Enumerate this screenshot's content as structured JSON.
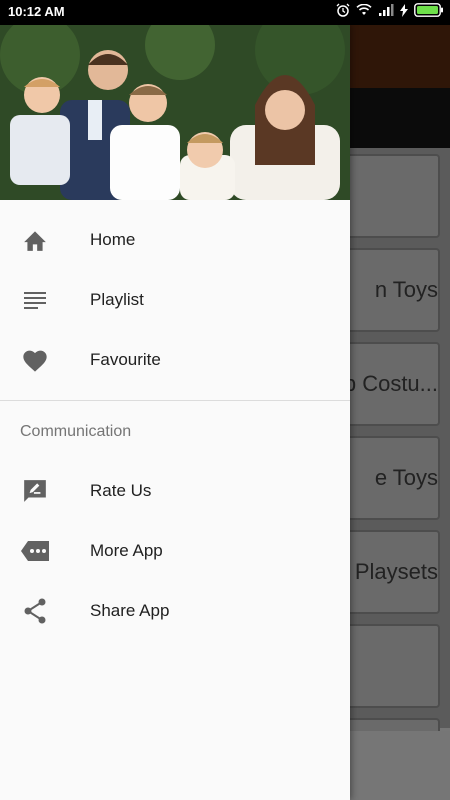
{
  "status_bar": {
    "time": "10:12 AM",
    "icons": [
      "alarm-icon",
      "wifi-icon",
      "signal-icon",
      "charging-icon",
      "battery-icon"
    ]
  },
  "background": {
    "cards": [
      "",
      "n Toys",
      "p Costu...",
      "e Toys",
      "Playsets",
      "",
      ""
    ],
    "header_color": "#2f1608"
  },
  "drawer": {
    "header_image": "family-photo",
    "menu": [
      {
        "label": "Home",
        "icon": "home-icon"
      },
      {
        "label": "Playlist",
        "icon": "playlist-icon"
      },
      {
        "label": "Favourite",
        "icon": "heart-icon"
      }
    ],
    "section_title": "Communication",
    "communication": [
      {
        "label": "Rate Us",
        "icon": "rate-feedback-icon"
      },
      {
        "label": "More App",
        "icon": "more-apps-icon"
      },
      {
        "label": "Share App",
        "icon": "share-icon"
      }
    ]
  },
  "colors": {
    "icon": "#616161",
    "text": "#212121",
    "battery": "#6ee04a"
  }
}
